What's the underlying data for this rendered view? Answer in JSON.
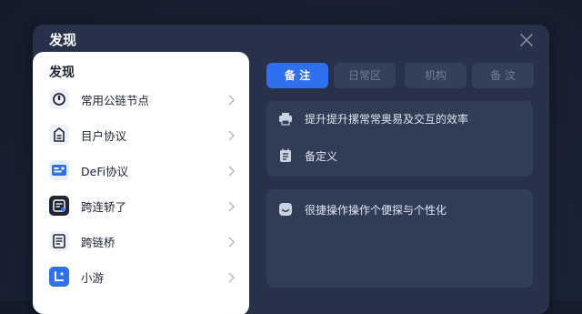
{
  "window": {
    "title": "发现"
  },
  "panel": {
    "title": "发现",
    "items": [
      {
        "label": "常用公链节点",
        "icon": "node-icon"
      },
      {
        "label": "目户协议",
        "icon": "protocol-icon"
      },
      {
        "label": "DeFi协议",
        "icon": "defi-icon"
      },
      {
        "label": "跨连轿了",
        "icon": "bridge-icon"
      },
      {
        "label": "跨链桥",
        "icon": "document-icon"
      },
      {
        "label": "小游",
        "icon": "game-icon"
      }
    ]
  },
  "tabs": [
    {
      "label": "备 注",
      "active": true
    },
    {
      "label": "日常区",
      "active": false
    },
    {
      "label": "机构",
      "active": false
    },
    {
      "label": "备 汶",
      "active": false
    }
  ],
  "cards": {
    "top": [
      {
        "text": "提升提升摞常常奥易及交互的效率",
        "icon": "printer-icon"
      },
      {
        "text": "备定义",
        "icon": "list-icon"
      }
    ],
    "bottom": [
      {
        "text": "很捷操作操作个便探与个性化",
        "icon": "smile-icon"
      }
    ]
  },
  "colors": {
    "accent": "#2f6ff0",
    "window_bg": "#27324a",
    "card_bg": "#313d56"
  }
}
